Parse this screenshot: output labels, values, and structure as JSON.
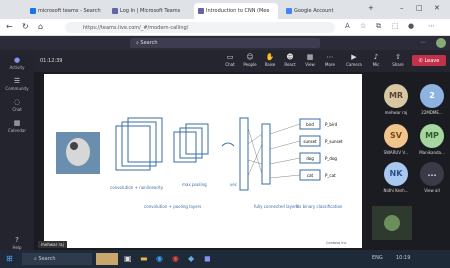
{
  "tabs": [
    {
      "label": "microsoft teams - Search",
      "active": false,
      "color": "#1a73e8"
    },
    {
      "label": "Log In | Microsoft Teams",
      "active": false,
      "color": "#6264a7"
    },
    {
      "label": "Introduction to CNN (Mee",
      "active": true,
      "color": "#6264a7"
    },
    {
      "label": "Google Account",
      "active": false,
      "color": "#4285f4"
    }
  ],
  "url": "https://teams.live.com/_#/modern-calling/",
  "search_placeholder": "Search",
  "rail": [
    "Activity",
    "Community",
    "Chat",
    "Calendar",
    "Help"
  ],
  "timer": "01:12:39",
  "toolbar": [
    "Chat",
    "People",
    "Raise",
    "React",
    "View",
    "More",
    "Camera",
    "Mic",
    "Share"
  ],
  "leave_label": "Leave",
  "slide": {
    "labels": {
      "conv": "convolution + nonlinearity",
      "pool": "max pooling",
      "vec": "vec",
      "convpool": "convolution + pooling layers",
      "fc": "fully connected layers",
      "nb": "Nx binary classification"
    },
    "classes": [
      "bird",
      "sunset",
      "dog",
      "cat"
    ],
    "probs": [
      "P_bird",
      "P_sunset",
      "P_dog",
      "P_cat"
    ],
    "tag": "Contoso Inc"
  },
  "participants": [
    {
      "initials": "MR",
      "name": "mehwar raj",
      "bg": "#d9c7a4",
      "fg": "#5a4630"
    },
    {
      "initials": "2",
      "name": "22MDME...",
      "bg": "#8fb3e0",
      "fg": "#fff"
    },
    {
      "initials": "SV",
      "name": "SWARUV V...",
      "bg": "#f0c48a",
      "fg": "#7a4a16"
    },
    {
      "initials": "MP",
      "name": "Manikanda...",
      "bg": "#a7d7a0",
      "fg": "#2f5e2a"
    },
    {
      "initials": "NK",
      "name": "Nidhi Kesh...",
      "bg": "#a9c8f0",
      "fg": "#2a4f86"
    },
    {
      "initials": "...",
      "name": "View all",
      "bg": "#3b3b48",
      "fg": "#ddd"
    }
  ],
  "presenter_tag": "mehwar raj",
  "taskbar": {
    "search": "Search",
    "lang": "ENG",
    "time": "10:19"
  }
}
